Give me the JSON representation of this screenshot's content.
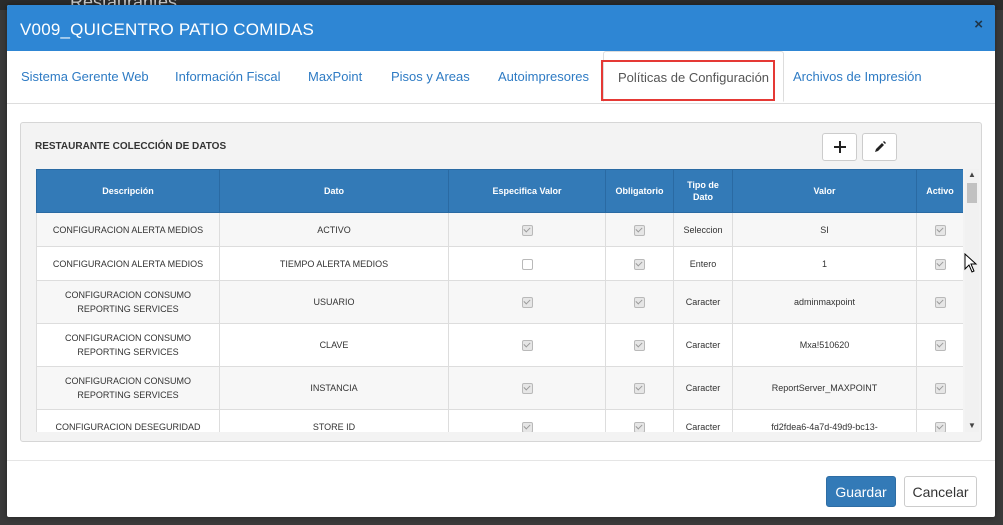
{
  "background": {
    "peek_title": "Restaurantes"
  },
  "modal": {
    "title": "V009_QUICENTRO PATIO COMIDAS",
    "close": "×"
  },
  "tabs": [
    {
      "label": "Sistema Gerente Web"
    },
    {
      "label": "Información Fiscal"
    },
    {
      "label": "MaxPoint"
    },
    {
      "label": "Pisos y Areas"
    },
    {
      "label": "Autoimpresores"
    },
    {
      "label": "Políticas de Configuración",
      "active": true
    },
    {
      "label": "Archivos de Impresión"
    }
  ],
  "panel": {
    "title": "RESTAURANTE COLECCIÓN DE DATOS",
    "add_icon": "plus-icon",
    "edit_icon": "pencil-icon"
  },
  "table": {
    "headers": [
      "Descripción",
      "Dato",
      "Especifica Valor",
      "Obligatorio",
      "Tipo de Dato",
      "Valor",
      "Activo"
    ],
    "rows": [
      {
        "descripcion": "CONFIGURACION ALERTA MEDIOS",
        "dato": "ACTIVO",
        "especifica_valor": true,
        "obligatorio": true,
        "tipo": "Seleccion",
        "valor": "SI",
        "activo": true
      },
      {
        "descripcion": "CONFIGURACION ALERTA MEDIOS",
        "dato": "TIEMPO ALERTA MEDIOS",
        "especifica_valor": false,
        "obligatorio": true,
        "tipo": "Entero",
        "valor": "1",
        "activo": true
      },
      {
        "descripcion": "CONFIGURACION CONSUMO REPORTING SERVICES",
        "dato": "USUARIO",
        "especifica_valor": true,
        "obligatorio": true,
        "tipo": "Caracter",
        "valor": "adminmaxpoint",
        "activo": true
      },
      {
        "descripcion": "CONFIGURACION CONSUMO REPORTING SERVICES",
        "dato": "CLAVE",
        "especifica_valor": true,
        "obligatorio": true,
        "tipo": "Caracter",
        "valor": "Mxa!510620",
        "activo": true
      },
      {
        "descripcion": "CONFIGURACION CONSUMO REPORTING SERVICES",
        "dato": "INSTANCIA",
        "especifica_valor": true,
        "obligatorio": true,
        "tipo": "Caracter",
        "valor": "ReportServer_MAXPOINT",
        "activo": true
      },
      {
        "descripcion": "CONFIGURACION DESEGURIDAD",
        "dato": "STORE ID",
        "especifica_valor": true,
        "obligatorio": true,
        "tipo": "Caracter",
        "valor": "fd2fdea6-4a7d-49d9-bc13-",
        "activo": true
      }
    ]
  },
  "footer": {
    "save_label": "Guardar",
    "cancel_label": "Cancelar"
  }
}
